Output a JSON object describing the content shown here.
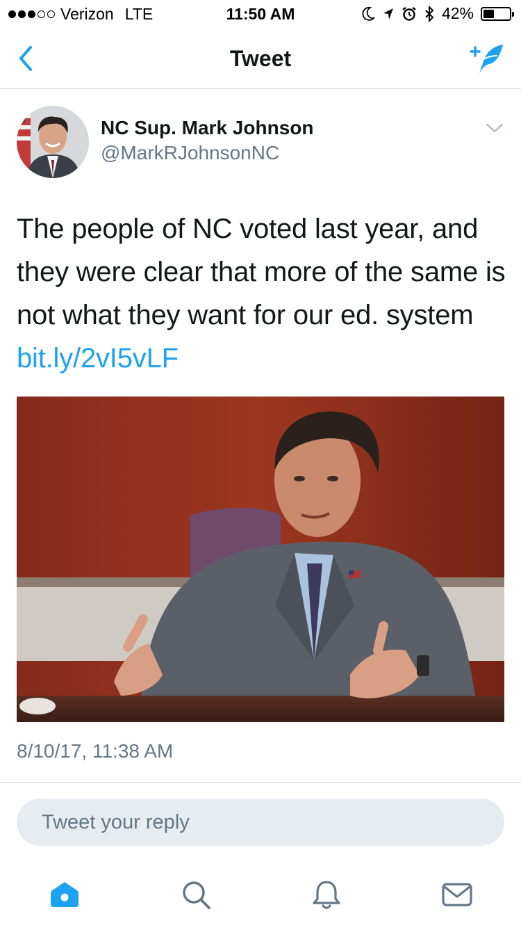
{
  "status_bar": {
    "carrier": "Verizon",
    "network": "LTE",
    "time": "11:50 AM",
    "battery_percent": "42%",
    "battery_level": 0.42
  },
  "nav": {
    "title": "Tweet"
  },
  "tweet": {
    "author_name": "NC Sup. Mark Johnson",
    "author_handle": "@MarkRJohnsonNC",
    "text": "The people of NC voted last year, and they were clear that more of the same is not what they want for our ed. system ",
    "link": "bit.ly/2vI5vLF",
    "timestamp": "8/10/17, 11:38 AM"
  },
  "reply": {
    "placeholder": "Tweet your reply"
  },
  "colors": {
    "accent": "#1da1f2",
    "text_primary": "#14171a",
    "text_secondary": "#657786",
    "reply_bg": "#e6ecf0",
    "divider": "#d5d9dd"
  },
  "icons": {
    "back": "chevron-left-icon",
    "compose": "compose-feather-icon",
    "caret": "chevron-down-icon",
    "home": "home-icon",
    "search": "search-icon",
    "notifications": "bell-icon",
    "messages": "envelope-icon"
  }
}
